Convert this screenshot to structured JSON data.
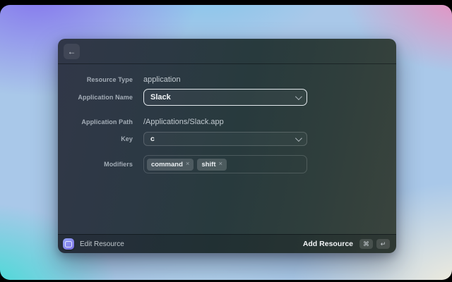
{
  "icons": {
    "back": "←",
    "chevron_down": "chevron-down",
    "tag_remove": "×",
    "command_key": "⌘",
    "return_key": "↵"
  },
  "colors": {
    "backdrop_purple": "#8577EE",
    "backdrop_teal": "#3FDCD5",
    "backdrop_pink": "#EF8ABC",
    "backdrop_cream": "#F6EFDC",
    "window_bg": "#2B3A44",
    "focus_border": "#E2E8EC",
    "app_icon_blue": "#7A6FE4"
  },
  "window": {
    "form": {
      "rows": [
        {
          "label": "Resource Type",
          "type": "static",
          "value": "application"
        },
        {
          "label": "Application Name",
          "type": "select",
          "value": "Slack",
          "focused": true
        },
        {
          "label": "Application Path",
          "type": "static",
          "value": "/Applications/Slack.app"
        },
        {
          "label": "Key",
          "type": "select",
          "value": "c"
        },
        {
          "label": "Modifiers",
          "type": "tags",
          "tags": [
            "command",
            "shift"
          ]
        }
      ]
    },
    "footer": {
      "left_label": "Edit Resource",
      "right_label": "Add Resource",
      "shortcut_keys": [
        "⌘",
        "↵"
      ]
    }
  }
}
